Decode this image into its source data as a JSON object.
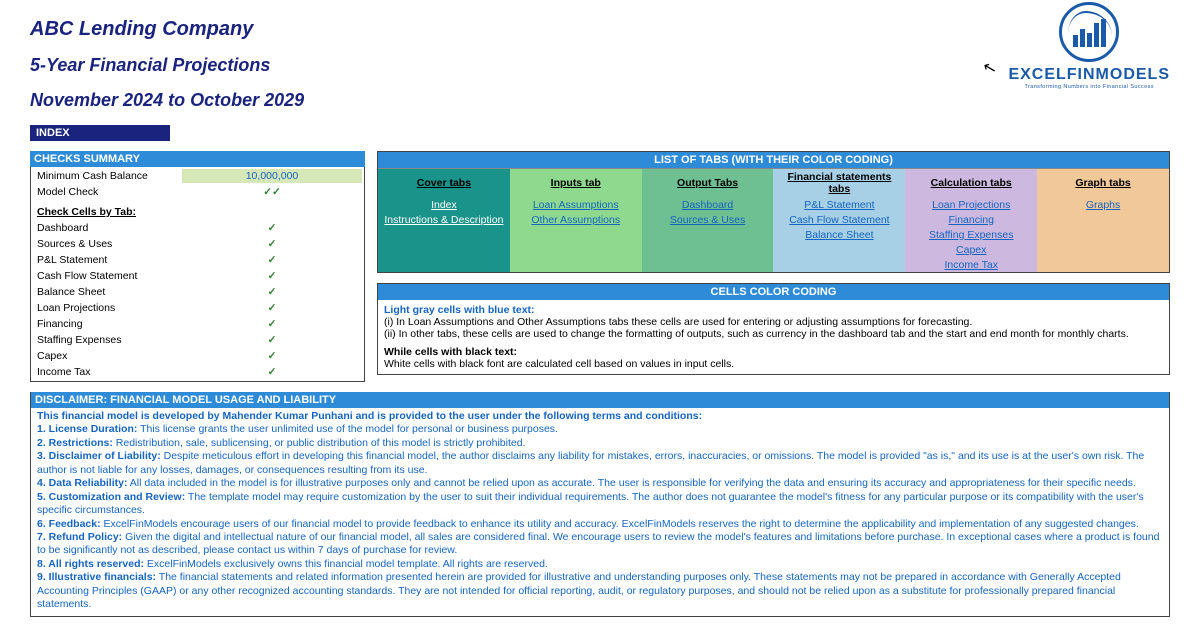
{
  "header": {
    "company": "ABC Lending Company",
    "title": "5-Year Financial Projections",
    "period": "November 2024 to October 2029",
    "logo_text": "EXCELFINMODELS",
    "logo_sub": "Transforming Numbers into Financial Success"
  },
  "index_label": "INDEX",
  "checks": {
    "title": "CHECKS  SUMMARY",
    "min_cash_label": "Minimum Cash Balance",
    "min_cash_value": "10,000,000",
    "model_check_label": "Model Check",
    "by_tab_label": "Check Cells by Tab:",
    "tabs": [
      "Dashboard",
      "Sources & Uses",
      "P&L Statement",
      "Cash Flow Statement",
      "Balance Sheet",
      "Loan Projections",
      "Financing",
      "Staffing Expenses",
      "Capex",
      "Income Tax"
    ],
    "tick": "✓✓"
  },
  "list_of_tabs": {
    "title": "LIST OF TABS (WITH THEIR COLOR CODING)",
    "columns": [
      {
        "header": "Cover tabs",
        "items": [
          "Index",
          "Instructions & Description"
        ]
      },
      {
        "header": "Inputs tab",
        "items": [
          "Loan Assumptions",
          "Other Assumptions"
        ]
      },
      {
        "header": "Output Tabs",
        "items": [
          "Dashboard",
          "Sources & Uses"
        ]
      },
      {
        "header": "Financial statements tabs",
        "items": [
          "P&L Statement",
          "Cash Flow Statement",
          "Balance Sheet"
        ]
      },
      {
        "header": "Calculation tabs",
        "items": [
          "Loan Projections",
          "Financing",
          "Staffing Expenses",
          "Capex ",
          "Income Tax"
        ]
      },
      {
        "header": "Graph tabs",
        "items": [
          "Graphs"
        ]
      }
    ]
  },
  "color_coding": {
    "title": "CELLS COLOR CODING",
    "line1": "Light gray cells with blue text:",
    "line2": "(i) In Loan Assumptions and Other Assumptions tabs these cells are used for entering or adjusting assumptions for forecasting.",
    "line3": "(ii) In other tabs, these cells are used to change the formatting of outputs, such as currency in the dashboard tab and the start and end month for monthly charts.",
    "line4": "While cells with black text:",
    "line5": "White cells with black font are calculated cell based on values in input cells."
  },
  "disclaimer": {
    "title": "DISCLAIMER: FINANCIAL MODEL USAGE AND LIABILITY",
    "intro": "This financial model  is developed by Mahender Kumar Punhani and is provided to the user under the following terms and conditions:",
    "items": [
      {
        "n": "1.",
        "b": "License Duration:",
        "t": " This license grants the user unlimited use of the model for personal or business purposes."
      },
      {
        "n": "2.",
        "b": "Restrictions:",
        "t": " Redistribution, sale, sublicensing, or public distribution of this model is strictly prohibited."
      },
      {
        "n": "3.",
        "b": "Disclaimer of Liability:",
        "t": " Despite meticulous effort in developing this financial model, the author disclaims any liability for mistakes, errors, inaccuracies, or omissions. The model is provided \"as is,\" and its use is at the user's own risk. The author is  not liable for any  losses, damages, or consequences resulting from its use."
      },
      {
        "n": "4.",
        "b": "Data Reliability:",
        "t": " All data included in the model is for illustrative purposes only and cannot be relied upon as accurate. The user is  responsible for verifying the data and ensuring its accuracy and appropriateness for their specific needs."
      },
      {
        "n": "5.",
        "b": "Customization and Review:",
        "t": " The template model may require customization by the user to suit their individual requirements. The author does not guarantee the model's fitness for any  particular purpose or its compatibility with the user's specific circumstances."
      },
      {
        "n": "6.",
        "b": "Feedback:",
        "t": " ExcelFinModels encourage users of our financial model to provide feedback to enhance its utility and accuracy. ExcelFinModels reserves the right to determine the applicability and implementation of any suggested changes."
      },
      {
        "n": "7.",
        "b": "Refund Policy:",
        "t": " Given the digital and intellectual nature of our financial model, all sales are considered final. We encourage users to review the model's features and limitations before purchase. In exceptional cases where a product is found to be  significantly not as described, please contact us within 7 days of purchase for review."
      },
      {
        "n": "8.",
        "b": "All rights reserved:",
        "t": " ExcelFinModels exclusively owns this financial model template. All rights are reserved."
      },
      {
        "n": "9.",
        "b": "Illustrative financials:",
        "t": " The financial statements and related information presented herein are provided for illustrative and understanding purposes only. These statements may not be prepared in accordance with Generally Accepted Accounting Principles (GAAP) or any other  recognized accounting standards. They are not intended for official reporting, audit, or regulatory purposes, and should not be relied upon as a substitute for professionally prepared financial statements."
      }
    ]
  }
}
